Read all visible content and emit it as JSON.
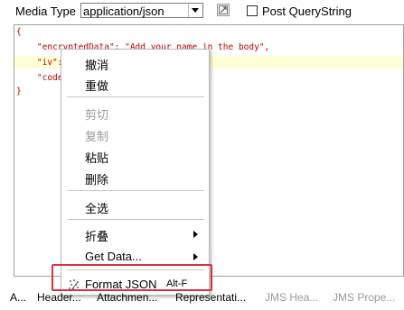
{
  "toolbar": {
    "media_type_label": "Media Type",
    "media_type_value": "application/json",
    "post_querystring_label": "Post QueryString",
    "post_querystring_checked": false
  },
  "editor": {
    "lines": [
      {
        "text": "{"
      },
      {
        "text": "    \"encryptedData\": \"Add your name in the body\","
      },
      {
        "text": "    \"iv\": \"A"
      },
      {
        "text": "    \"code\""
      },
      {
        "text": "}"
      }
    ]
  },
  "context_menu": {
    "items": [
      {
        "label": "撤消",
        "enabled": true
      },
      {
        "label": "重做",
        "enabled": true
      },
      {
        "label": "剪切",
        "enabled": false
      },
      {
        "label": "复制",
        "enabled": false
      },
      {
        "label": "粘贴",
        "enabled": true
      },
      {
        "label": "删除",
        "enabled": true
      },
      {
        "label": "全选",
        "enabled": true
      },
      {
        "label": "折叠",
        "enabled": true,
        "submenu": true
      },
      {
        "label": "Get Data...",
        "enabled": true,
        "submenu": true
      },
      {
        "label": "Format JSON",
        "enabled": true,
        "shortcut": "Alt-F",
        "icon": "format-json-icon",
        "highlighted_box_color": "#d9323f"
      }
    ]
  },
  "bottom_tabs": [
    {
      "label": "A...",
      "enabled": true
    },
    {
      "label": "Header...",
      "enabled": true
    },
    {
      "label": "Attachmen...",
      "enabled": true
    },
    {
      "label": "Representati...",
      "enabled": true
    },
    {
      "label": "JMS Hea...",
      "enabled": false
    },
    {
      "label": "JMS Prope...",
      "enabled": false
    }
  ],
  "colors": {
    "string_text": "#c00000",
    "key_text": "#b0007f",
    "current_line_highlight": "#ffffd7",
    "annotation_box": "#d9323f"
  }
}
